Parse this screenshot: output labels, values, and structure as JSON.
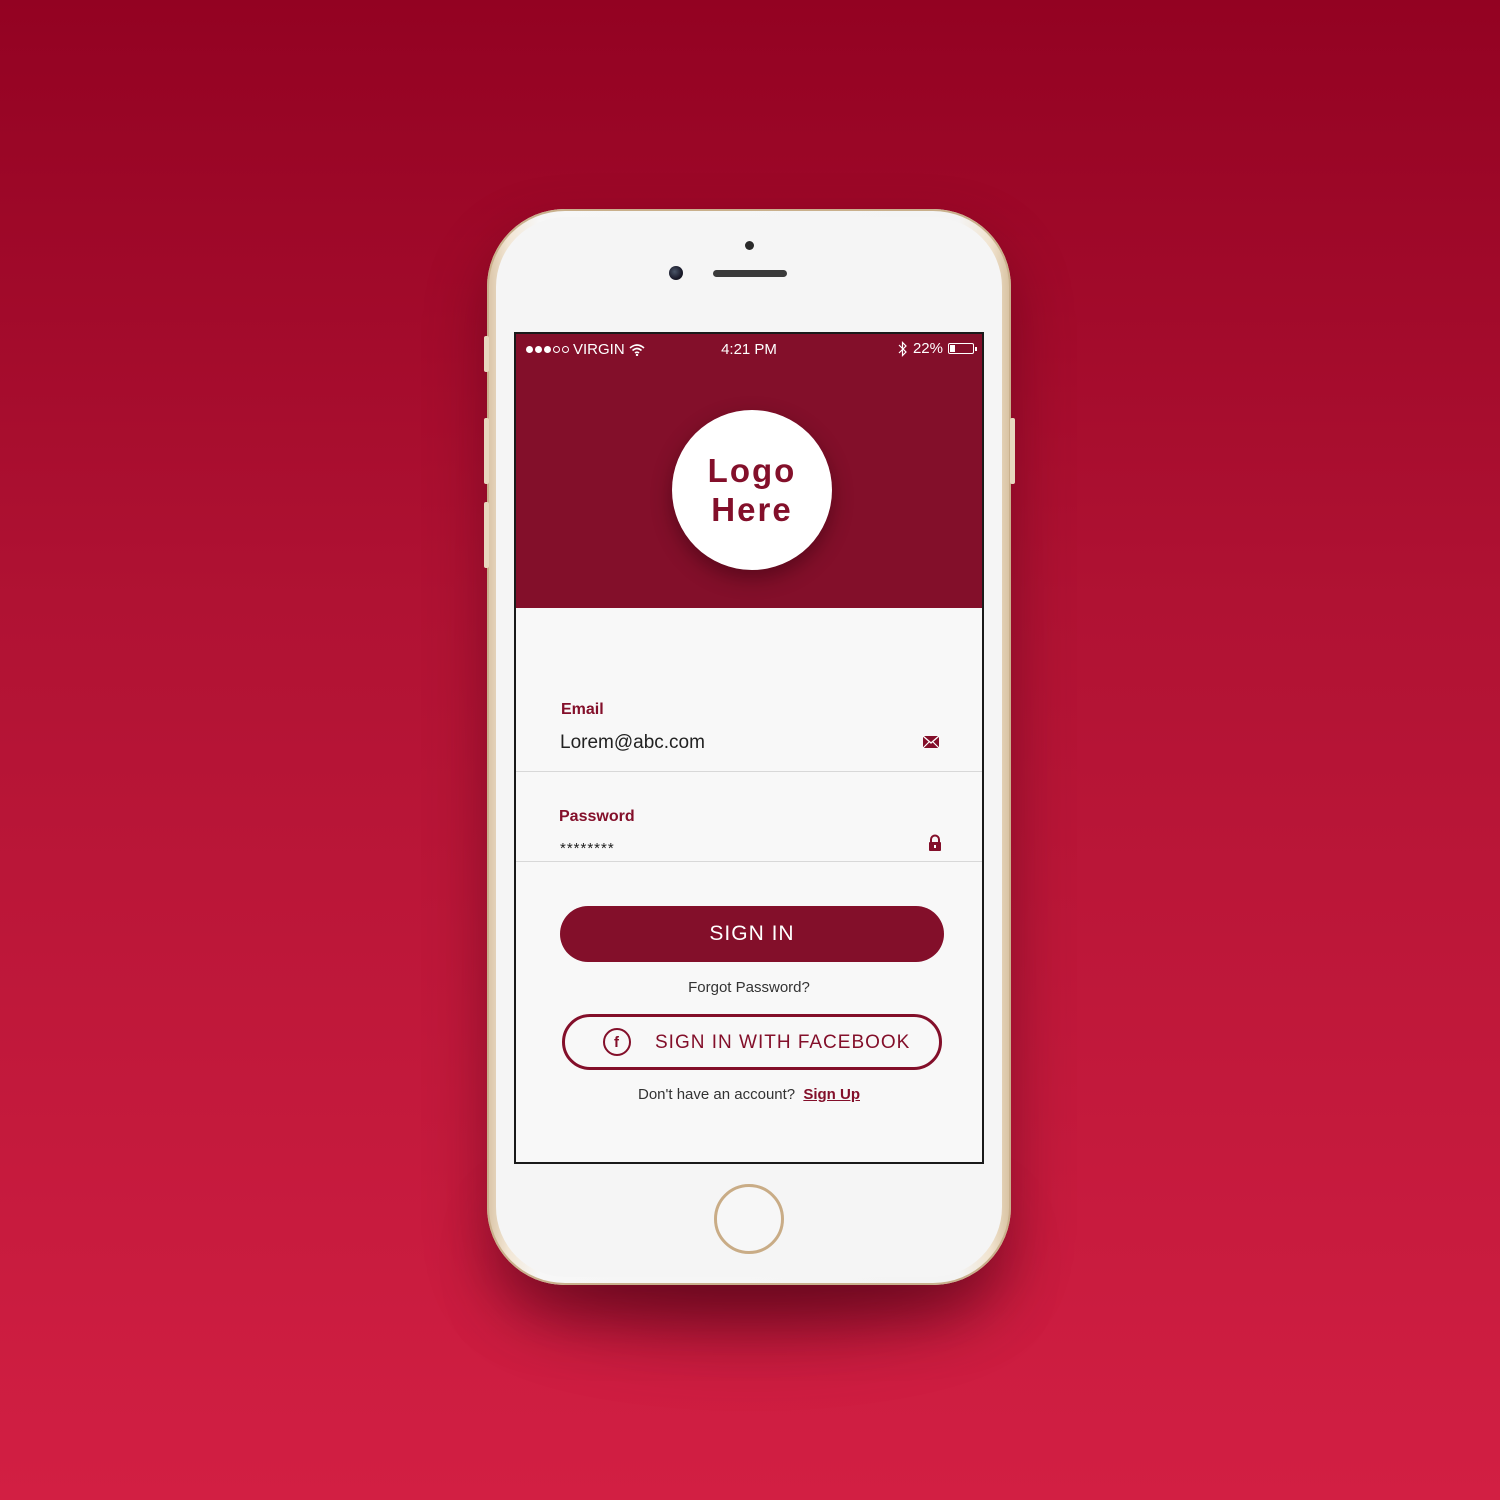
{
  "status_bar": {
    "carrier": "VIRGIN",
    "time": "4:21 PM",
    "battery": "22%",
    "battery_level": 0.22
  },
  "logo": {
    "line1": "Logo",
    "line2": "Here"
  },
  "email": {
    "label": "Email",
    "value": "Lorem@abc.com",
    "icon": "envelope-icon"
  },
  "password": {
    "label": "Password",
    "value": "********",
    "icon": "lock-icon"
  },
  "signin_button": "SIGN IN",
  "forgot_password": "Forgot Password?",
  "facebook_button": {
    "icon_glyph": "f",
    "label": "SIGN IN WITH FACEBOOK"
  },
  "signup": {
    "prompt": "Don't have an account?",
    "link": "Sign Up"
  },
  "colors": {
    "brand": "#830f2a",
    "background_top": "#930222",
    "background_bottom": "#d21f43"
  }
}
